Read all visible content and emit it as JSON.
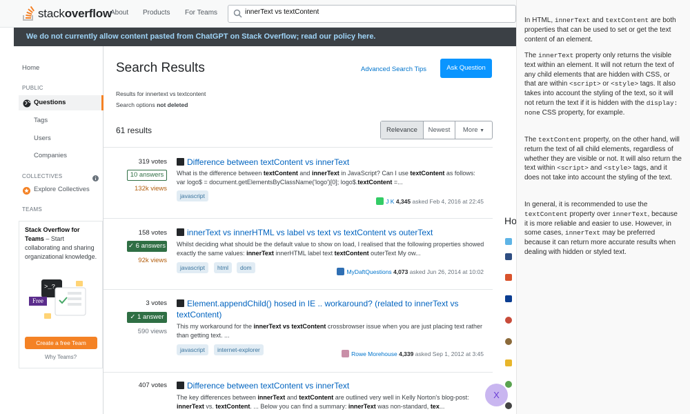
{
  "topbar": {
    "logo_prefix": "stack",
    "logo_bold": "overflow",
    "nav": [
      "About",
      "Products",
      "For Teams"
    ],
    "search_value": "innerText vs textContent"
  },
  "banner": {
    "text": "We do not currently allow content pasted from ChatGPT on Stack Overflow; read our policy here."
  },
  "sidebar": {
    "home": "Home",
    "public_head": "PUBLIC",
    "questions": "Questions",
    "tags": "Tags",
    "users": "Users",
    "companies": "Companies",
    "collectives_head": "COLLECTIVES",
    "explore_collectives": "Explore Collectives",
    "teams_head": "TEAMS",
    "teams_title": "Stack Overflow for Teams",
    "teams_desc": " – Start collaborating and sharing organizational knowledge.",
    "free_badge": "Free",
    "create_team": "Create a free Team",
    "why_teams": "Why Teams?"
  },
  "main": {
    "title": "Search Results",
    "advanced_tips": "Advanced Search Tips",
    "ask_button": "Ask Question",
    "results_for": "Results for innertext vs textcontent",
    "search_options_prefix": "Search options ",
    "search_options_value": "not deleted",
    "results_count": "61 results",
    "sort": [
      "Relevance",
      "Newest",
      "More"
    ],
    "questions": [
      {
        "votes": "319 votes",
        "answers": "10 answers",
        "views": "132k views",
        "title": "Difference between textContent vs innerText",
        "excerpt_html": "What is the difference between <b>textContent</b> and <b>innerText</b> in JavaScript? Can I use <b>textContent</b> as follows: var logo$ = document.getElementsByClassName('logo')[0]; logo$.<b>textContent</b> =...",
        "tags": [
          "javascript"
        ],
        "user": "J K",
        "rep": "4,345",
        "asked": "asked Feb 4, 2016 at 22:45"
      },
      {
        "votes": "158 votes",
        "answers": "6 answers",
        "views": "92k views",
        "title": "innerText vs innerHTML vs label vs text vs textContent vs outerText",
        "excerpt_html": "Whilst deciding what should be the default value to show on load, I realised that the following proper­ties showed exactly the same values: <b>innerText</b> innerHTML label text <b>textContent</b> outerText My ow...",
        "tags": [
          "javascript",
          "html",
          "dom"
        ],
        "user": "MyDaftQuestions",
        "rep": "4,073",
        "asked": "asked Jun 26, 2014 at 10:02"
      },
      {
        "votes": "3 votes",
        "answers": "1 answer",
        "views": "590 views",
        "title": "Element.appendChild() hosed in IE .. workaround? (related to innerText vs textContent)",
        "excerpt_html": "This my workaround for the <b>innerText vs textContent</b> crossbrowser issue when you are just placing text rather than getting text. ...",
        "tags": [
          "javascript",
          "internet-explorer"
        ],
        "user": "Rowe Morehouse",
        "rep": "4,339",
        "asked": "asked Sep 1, 2012 at 3:45"
      },
      {
        "votes": "407 votes",
        "title": "Difference between textContent vs innerText",
        "excerpt_html": "The key differences between <b>innerText</b> and <b>textContent</b> are outlined very well in Kelly Norton's blog-post: <b>innerText</b> vs. <b>textContent</b>. ... Below you can find a summary: <b>innerText</b> was non-standard, <b>tex</b>..."
      }
    ]
  },
  "right_strip": {
    "heading": "Ho"
  },
  "panel": {
    "p1_html": "In HTML, <code>innerText</code> and <code>textContent</code> are both properties that can be used to set or get the text content of an element.",
    "p2_html": "The <code>innerText</code> property only returns the visible text within an element. It will not return the text of any child elements that are hidden with CSS, or that are within <code>&lt;script&gt;</code> or <code>&lt;style&gt;</code> tags. It also takes into account the styling of the text, so it will not return the text if it is hidden with the <code>display: none</code> CSS property, for example.",
    "p3_html": "The <code>textContent</code> property, on the other hand, will return the text of all child elements, regardless of whether they are visible or not. It will also return the text within <code>&lt;script&gt;</code> and <code>&lt;style&gt;</code> tags, and it does not take into account the styling of the text.",
    "p4_html": "In general, it is recommended to use the <code>textContent</code> property over <code>innerText</code>, because it is more reliable and easier to use. However, in some cases, <code>innerText</code> may be preferred because it can return more accurate results when dealing with hidden or styled text."
  },
  "fab": {
    "label": "X"
  },
  "colors": {
    "accent": "#0a95ff",
    "orange": "#f48225",
    "answered_green": "#2f6f44",
    "hot_views": "#b25c0b"
  }
}
